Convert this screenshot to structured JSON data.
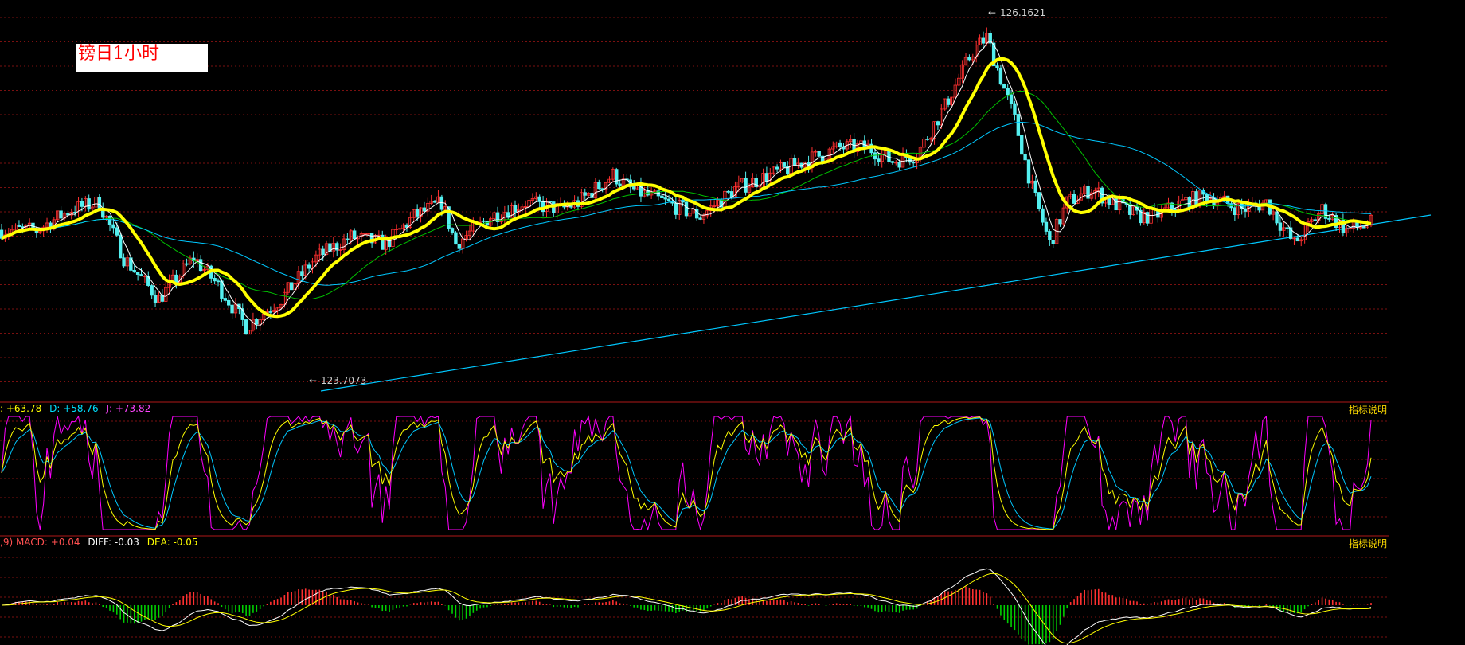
{
  "title": "镑日1小时",
  "price_panel": {
    "high_label": "126.1621",
    "low_label": "123.7073"
  },
  "kdj_panel": {
    "k_text": ": +63.78",
    "d_text": "D: +58.76",
    "j_text": "J: +73.82",
    "help": "指标说明"
  },
  "macd_panel": {
    "macd_text": ",9) MACD: +0.04",
    "diff_text": "DIFF: -0.03",
    "dea_text": "DEA: -0.05",
    "help": "指标说明"
  },
  "colors": {
    "background": "#000000",
    "grid": "#7a1010",
    "candle_up": "#ff3030",
    "candle_down": "#54f0f0",
    "ma_yellow": "#ffff00",
    "ma_cyan": "#00c8ff",
    "ma_green": "#00c000",
    "ma_white": "#ffffff",
    "k": "#ffffff",
    "d": "#ffff00",
    "j": "#ff00ff",
    "macd_up": "#ff3030",
    "macd_down": "#00d000",
    "diff": "#ffffff",
    "dea": "#ffff00",
    "trendline": "#00c8ff"
  },
  "chart_data": {
    "type": "candlestick",
    "title": "镑日1小时",
    "symbol": "GBP/JPY",
    "timeframe": "1H",
    "y_high_marker": 126.1621,
    "y_low_marker": 123.7073,
    "ylim": [
      123.55,
      126.3
    ],
    "price_path": [
      [
        0,
        124.7
      ],
      [
        10,
        124.7
      ],
      [
        20,
        124.85
      ],
      [
        28,
        124.9
      ],
      [
        35,
        124.5
      ],
      [
        45,
        124.2
      ],
      [
        55,
        124.5
      ],
      [
        62,
        124.3
      ],
      [
        70,
        124.0
      ],
      [
        80,
        124.2
      ],
      [
        90,
        124.5
      ],
      [
        100,
        124.65
      ],
      [
        110,
        124.6
      ],
      [
        118,
        124.8
      ],
      [
        126,
        124.9
      ],
      [
        130,
        124.6
      ],
      [
        140,
        124.8
      ],
      [
        150,
        124.9
      ],
      [
        160,
        124.85
      ],
      [
        165,
        124.9
      ],
      [
        175,
        125.1
      ],
      [
        180,
        125.0
      ],
      [
        190,
        124.9
      ],
      [
        200,
        124.8
      ],
      [
        210,
        125.0
      ],
      [
        220,
        125.1
      ],
      [
        230,
        125.2
      ],
      [
        240,
        125.3
      ],
      [
        248,
        125.3
      ],
      [
        255,
        125.2
      ],
      [
        262,
        125.25
      ],
      [
        270,
        125.6
      ],
      [
        278,
        126.0
      ],
      [
        282,
        126.1
      ],
      [
        286,
        125.8
      ],
      [
        290,
        125.5
      ],
      [
        295,
        125.0
      ],
      [
        300,
        124.6
      ],
      [
        305,
        124.9
      ],
      [
        312,
        125.0
      ],
      [
        318,
        124.9
      ],
      [
        325,
        124.8
      ],
      [
        330,
        124.8
      ],
      [
        338,
        124.9
      ],
      [
        345,
        124.95
      ],
      [
        355,
        124.85
      ],
      [
        362,
        124.9
      ],
      [
        370,
        124.6
      ],
      [
        378,
        124.85
      ],
      [
        385,
        124.7
      ],
      [
        392,
        124.75
      ]
    ],
    "kdj": {
      "k": 63.78,
      "d": 58.76,
      "j": 73.82
    },
    "macd": {
      "macd": 0.04,
      "diff": -0.03,
      "dea": -0.05
    }
  }
}
